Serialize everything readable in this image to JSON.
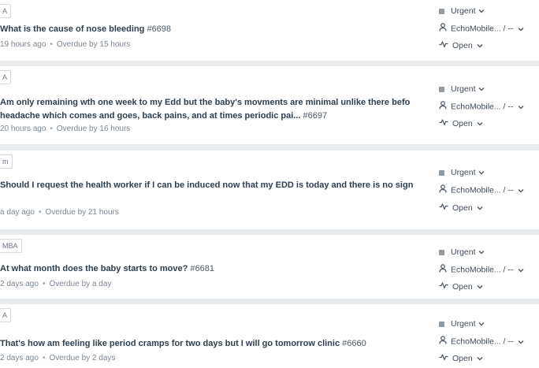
{
  "tickets": [
    {
      "tag": "A",
      "title": "What is the cause of nose bleeding",
      "number": "#6698",
      "title_line2": "",
      "created": "19 hours ago",
      "due": "Overdue by 15 hours",
      "priority": "Urgent",
      "group": "EchoMobile...",
      "agent": "/ --",
      "status": "Open"
    },
    {
      "tag": "A",
      "title": "Am only remaining wth one week to my Edd but the baby's movments are minimal unlike there befo",
      "number": "#6697",
      "title_line2": "headache which comes and goes, back pains, and at times periodic pai...",
      "created": "20 hours ago",
      "due": "Overdue by 16 hours",
      "priority": "Urgent",
      "group": "EchoMobile...",
      "agent": "/ --",
      "status": "Open"
    },
    {
      "tag": "m",
      "title": "Should I request the health worker if I can be induced now that my EDD is today and there is no sign",
      "number": "",
      "title_line2": "",
      "created": "a day ago",
      "due": "Overdue by 21 hours",
      "priority": "Urgent",
      "group": "EchoMobile...",
      "agent": "/ --",
      "status": "Open"
    },
    {
      "tag": "MBA",
      "title": "At what month does the baby starts to move?",
      "number": "#6681",
      "title_line2": "",
      "created": "2 days ago",
      "due": "Overdue by a day",
      "priority": "Urgent",
      "group": "EchoMobile...",
      "agent": "/ --",
      "status": "Open"
    },
    {
      "tag": "A",
      "title": "That's how am feeling like period cramps for two days but I will go tomorrow clinic",
      "number": "#6660",
      "title_line2": "",
      "created": "2 days ago",
      "due": "Overdue by 2 days",
      "priority": "Urgent",
      "group": "EchoMobile...",
      "agent": "/ --",
      "status": "Open"
    }
  ],
  "meta_separator": "•",
  "colors": {
    "background": "#e9ecef",
    "card": "#ffffff",
    "title": "#2c3e50",
    "meta": "#7a8793",
    "priority_square": "#8f9aa4"
  },
  "icons": {
    "priority": "priority-square-icon",
    "group": "person-icon",
    "status": "activity-pulse-icon",
    "dropdown": "chevron-down-icon"
  }
}
